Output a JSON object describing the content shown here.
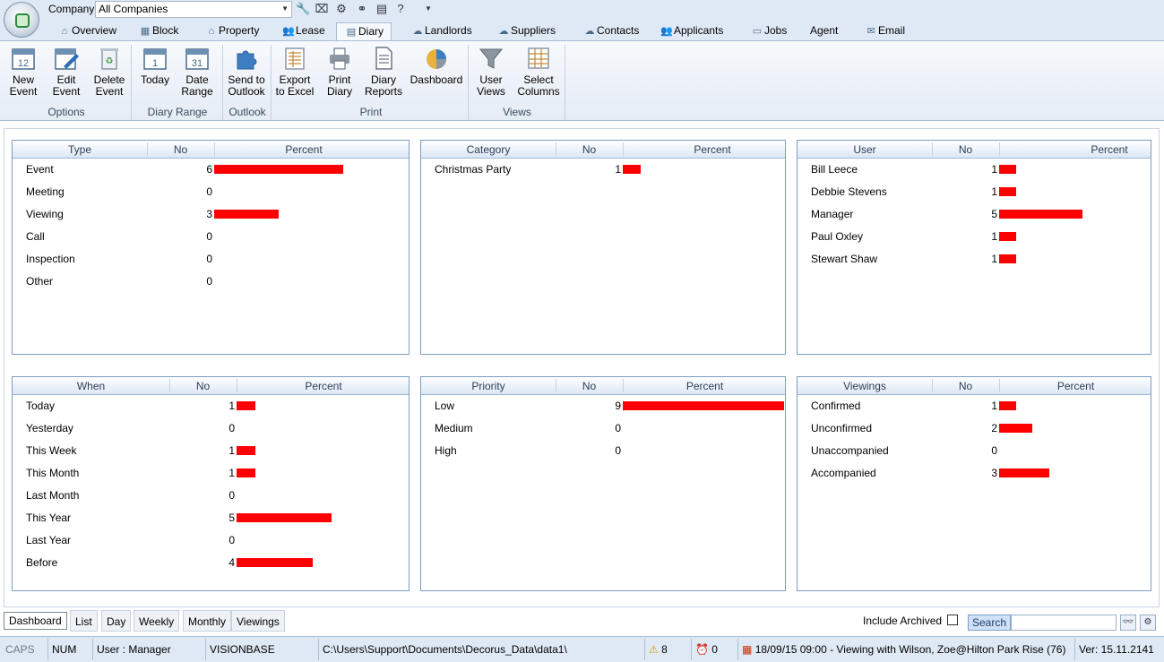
{
  "topbar": {
    "company_label": "Company",
    "company_value": "All Companies",
    "quick_icons": [
      "wrench-icon",
      "camera-icon",
      "network-icon",
      "hierarchy-icon",
      "document-icon",
      "help-icon",
      "dropdown-arrow-icon"
    ]
  },
  "tabs": [
    {
      "label": "Overview",
      "icon": "overview-icon"
    },
    {
      "label": "Block",
      "icon": "block-icon"
    },
    {
      "label": "Property",
      "icon": "property-icon"
    },
    {
      "label": "Lease",
      "icon": "lease-icon"
    },
    {
      "label": "Diary",
      "icon": "diary-icon",
      "active": true
    },
    {
      "label": "Landlords",
      "icon": "landlords-icon"
    },
    {
      "label": "Suppliers",
      "icon": "suppliers-icon"
    },
    {
      "label": "Contacts",
      "icon": "contacts-icon"
    },
    {
      "label": "Applicants",
      "icon": "applicants-icon"
    },
    {
      "label": "Jobs",
      "icon": "jobs-icon"
    },
    {
      "label": "Agent",
      "icon": ""
    },
    {
      "label": "Email",
      "icon": "email-icon"
    }
  ],
  "ribbon": {
    "buttons": {
      "new_event": "New\nEvent",
      "edit_event": "Edit\nEvent",
      "delete_event": "Delete\nEvent",
      "today": "Today",
      "date_range": "Date\nRange",
      "send_outlook": "Send to\nOutlook",
      "export_excel": "Export\nto Excel",
      "print_diary": "Print\nDiary",
      "diary_reports": "Diary\nReports",
      "dashboard": "Dashboard",
      "user_views": "User\nViews",
      "select_columns": "Select\nColumns"
    },
    "groups": {
      "options": "Options",
      "diary_range": "Diary Range",
      "outlook": "Outlook",
      "print": "Print",
      "views": "Views"
    }
  },
  "panels": {
    "type": {
      "headers": [
        "Type",
        "No",
        "Percent"
      ],
      "rows": [
        {
          "label": "Event",
          "no": "6"
        },
        {
          "label": "Meeting",
          "no": "0"
        },
        {
          "label": "Viewing",
          "no": "3"
        },
        {
          "label": "Call",
          "no": "0"
        },
        {
          "label": "Inspection",
          "no": "0"
        },
        {
          "label": "Other",
          "no": "0"
        }
      ]
    },
    "category": {
      "headers": [
        "Category",
        "No",
        "Percent"
      ],
      "rows": [
        {
          "label": "Christmas Party",
          "no": "1"
        }
      ]
    },
    "user": {
      "headers": [
        "User",
        "No",
        "Percent"
      ],
      "rows": [
        {
          "label": "Bill Leece",
          "no": "1"
        },
        {
          "label": "Debbie Stevens",
          "no": "1"
        },
        {
          "label": "Manager",
          "no": "5"
        },
        {
          "label": "Paul Oxley",
          "no": "1"
        },
        {
          "label": "Stewart Shaw",
          "no": "1"
        }
      ]
    },
    "when": {
      "headers": [
        "When",
        "No",
        "Percent"
      ],
      "rows": [
        {
          "label": "Today",
          "no": "1"
        },
        {
          "label": "Yesterday",
          "no": "0"
        },
        {
          "label": "This Week",
          "no": "1"
        },
        {
          "label": "This Month",
          "no": "1"
        },
        {
          "label": "Last Month",
          "no": "0"
        },
        {
          "label": "This Year",
          "no": "5"
        },
        {
          "label": "Last Year",
          "no": "0"
        },
        {
          "label": "Before",
          "no": "4"
        }
      ]
    },
    "priority": {
      "headers": [
        "Priority",
        "No",
        "Percent"
      ],
      "rows": [
        {
          "label": "Low",
          "no": "9"
        },
        {
          "label": "Medium",
          "no": "0"
        },
        {
          "label": "High",
          "no": "0"
        }
      ]
    },
    "viewings": {
      "headers": [
        "Viewings",
        "No",
        "Percent"
      ],
      "rows": [
        {
          "label": "Confirmed",
          "no": "1"
        },
        {
          "label": "Unconfirmed",
          "no": "2"
        },
        {
          "label": "Unaccompanied",
          "no": "0"
        },
        {
          "label": "Accompanied",
          "no": "3"
        }
      ]
    }
  },
  "bar_color": "#ff0000",
  "bottom_tabs": [
    "Dashboard",
    "List",
    "Day",
    "Weekly",
    "Monthly",
    "Viewings"
  ],
  "filter": {
    "include_archived": "Include Archived",
    "search_label": "Search",
    "search_value": ""
  },
  "status": {
    "caps": "CAPS",
    "num": "NUM",
    "user": "User : Manager",
    "db": "VISIONBASE",
    "path": "C:\\Users\\Support\\Documents\\Decorus_Data\\data1\\",
    "warnings": "8",
    "alarms": "0",
    "appointment": "18/09/15 09:00 - Viewing with Wilson, Zoe@Hilton Park Rise (76)",
    "version": "Ver: 15.11.2141"
  }
}
